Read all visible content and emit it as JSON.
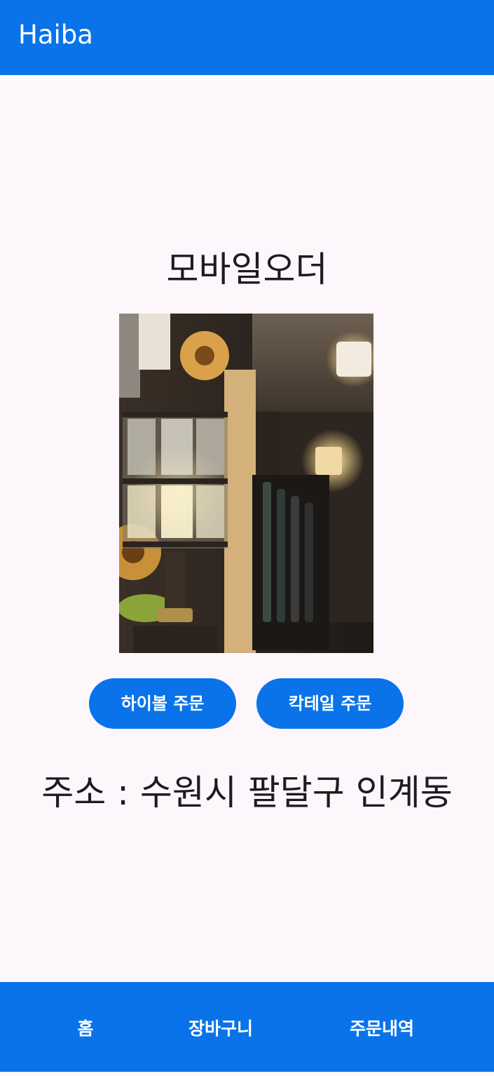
{
  "app_bar": {
    "title": "Haiba"
  },
  "main": {
    "heading": "모바일오더",
    "image_label": "bar-interior-photo",
    "buttons": {
      "highball": "하이볼 주문",
      "cocktail": "칵테일 주문"
    },
    "address": "주소 : 수원시 팔달구 인계동"
  },
  "bottom_nav": {
    "items": [
      "홈",
      "장바구니",
      "주문내역"
    ]
  },
  "colors": {
    "primary": "#0a73ea",
    "background": "#fdf7fc",
    "on_primary": "#ffffff",
    "text": "#1d1b20"
  }
}
